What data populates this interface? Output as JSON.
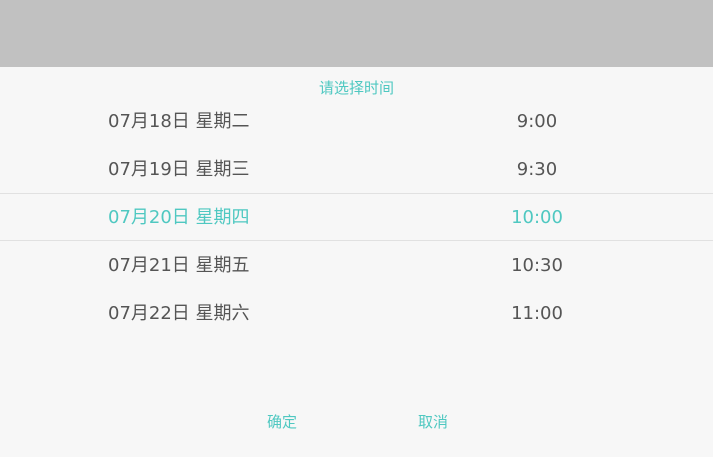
{
  "header": {
    "title": "请选择时间"
  },
  "picker": {
    "dates": [
      {
        "label": "07月18日 星期二"
      },
      {
        "label": "07月19日 星期三"
      },
      {
        "label": "07月20日 星期四"
      },
      {
        "label": "07月21日 星期五"
      },
      {
        "label": "07月22日 星期六"
      }
    ],
    "times": [
      {
        "label": "9:00"
      },
      {
        "label": "9:30"
      },
      {
        "label": "10:00"
      },
      {
        "label": "10:30"
      },
      {
        "label": "11:00"
      }
    ],
    "selected_date": "07月20日 星期四",
    "selected_time": "10:00"
  },
  "actions": {
    "confirm_label": "确定",
    "cancel_label": "取消"
  },
  "colors": {
    "accent": "#4fc8c1",
    "backdrop": "#c1c1c1",
    "sheet": "#f7f7f7",
    "text": "#555555"
  }
}
